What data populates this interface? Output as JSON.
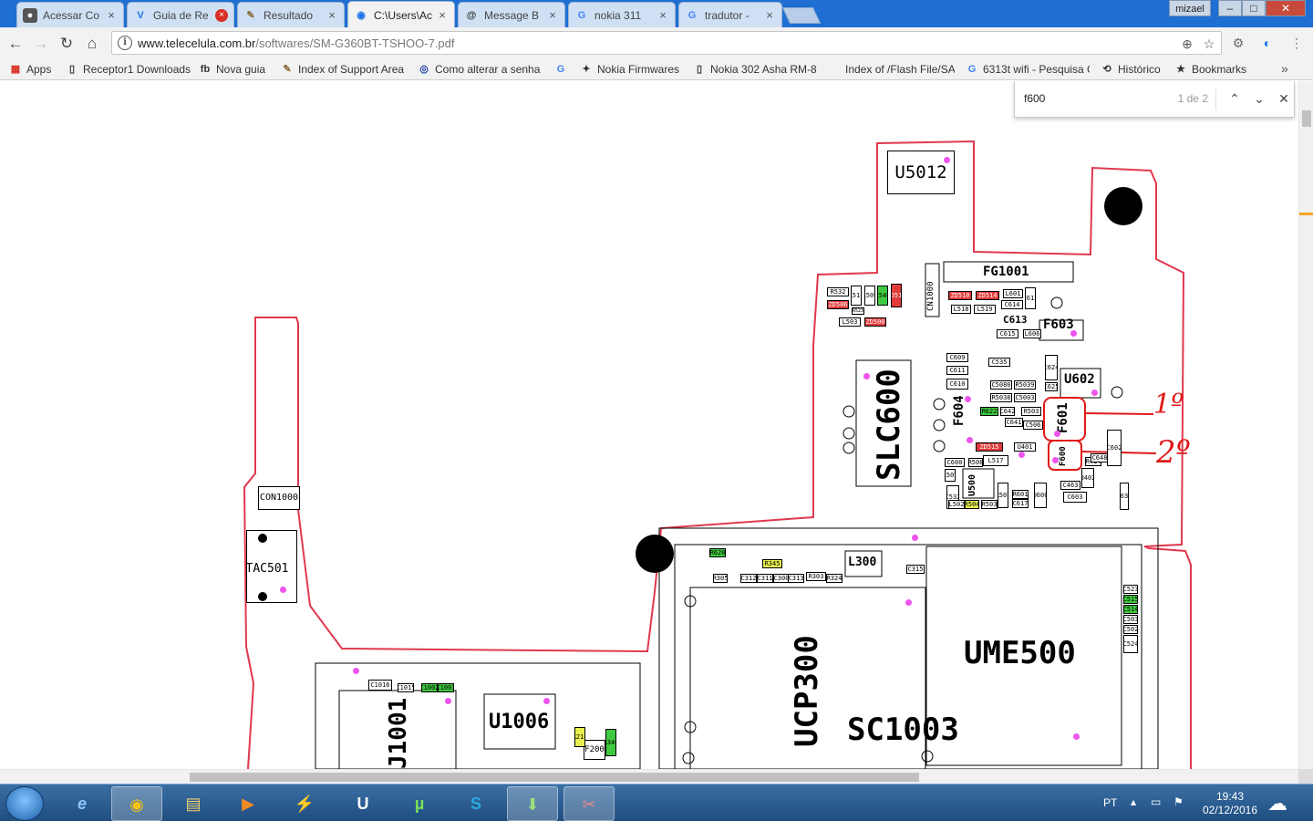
{
  "window": {
    "user": "mizael",
    "controls": {
      "minimize": "–",
      "maximize": "□",
      "close": "✕"
    }
  },
  "tabs": [
    {
      "title": "Acessar Co",
      "icon": "incognito-icon",
      "icon_glyph": "●",
      "close": "×",
      "close_variant": "normal",
      "active": false
    },
    {
      "title": "Guia de Re",
      "icon": "vpn-icon",
      "icon_glyph": "V",
      "close": "×",
      "close_variant": "error",
      "active": false
    },
    {
      "title": "Resultado",
      "icon": "pen-icon",
      "icon_glyph": "✎",
      "close": "×",
      "close_variant": "normal",
      "active": false
    },
    {
      "title": "C:\\Users\\Ac",
      "icon": "globe-icon",
      "icon_glyph": "◉",
      "close": "×",
      "close_variant": "normal",
      "active": true
    },
    {
      "title": "Message B",
      "icon": "spiral-icon",
      "icon_glyph": "@",
      "close": "×",
      "close_variant": "normal",
      "active": false
    },
    {
      "title": "nokia 311",
      "icon": "google-icon",
      "icon_glyph": "G",
      "close": "×",
      "close_variant": "normal",
      "active": false
    },
    {
      "title": "tradutor - ",
      "icon": "google-icon",
      "icon_glyph": "G",
      "close": "×",
      "close_variant": "normal",
      "active": false
    }
  ],
  "toolbar": {
    "back": "←",
    "forward": "→",
    "reload": "↻",
    "home": "⌂",
    "info": "i",
    "url_host": "www.telecelula.com.br",
    "url_path": "/softwares/SM-G360BT-TSHOO-7.pdf",
    "zoom_glyph": "⊕",
    "star_glyph": "☆",
    "ext1": "⚙",
    "ext2": "◐",
    "menu": "⋮"
  },
  "bookmarks": [
    {
      "label": "Apps",
      "icon": "apps-grid-icon",
      "glyph": "▦",
      "color": "#d93025"
    },
    {
      "label": "Receptor1 Downloads",
      "icon": "page-icon",
      "glyph": "▯",
      "color": "#555555"
    },
    {
      "label": "Nova guia",
      "icon": "facebook-icon",
      "glyph": "fb",
      "color": "#333333"
    },
    {
      "label": "Index of Support Area",
      "icon": "pen-icon",
      "glyph": "✎",
      "color": "#8a6d3b"
    },
    {
      "label": "Como alterar a senha",
      "icon": "tplink-icon",
      "glyph": "◎",
      "color": "#1a3ba8"
    },
    {
      "label": "",
      "icon": "google-icon",
      "glyph": "G",
      "color": "#4285f4"
    },
    {
      "label": "Nokia Firmwares",
      "icon": "wrench-icon",
      "glyph": "✦",
      "color": "#333333"
    },
    {
      "label": "Nokia 302 Asha RM-8",
      "icon": "page-icon",
      "glyph": "▯",
      "color": "#555555"
    },
    {
      "label": "Index of /Flash File/SA",
      "icon": "",
      "glyph": "",
      "color": "#555555"
    },
    {
      "label": "6313t wifi - Pesquisa G",
      "icon": "google-icon",
      "glyph": "G",
      "color": "#4285f4"
    },
    {
      "label": "Histórico",
      "icon": "history-icon",
      "glyph": "⟲",
      "color": "#555555"
    },
    {
      "label": "Bookmarks",
      "icon": "star-icon",
      "glyph": "★",
      "color": "#555555"
    }
  ],
  "bookmarks_more": "»",
  "findbar": {
    "query": "f600",
    "count": "1 de 2",
    "prev": "⌃",
    "next": "⌄",
    "close": "✕"
  },
  "schematic": {
    "big_labels": {
      "u5012": "U5012",
      "fg1001": "FG1001",
      "slc600": "SLC600",
      "ume500": "UME500",
      "ucp300": "UCP300",
      "sc1003": "SC1003",
      "u1006": "U1006",
      "j1001": "J1001",
      "u602": "U602",
      "f603": "F603",
      "f601": "F601",
      "f604": "F604",
      "tac501": "TAC501",
      "con1000": "CON1000",
      "l300": "L300",
      "cn1000": "CN1000",
      "f600": "F600",
      "f200": "F200",
      "u500": "U500",
      "c613": "C613"
    },
    "small_labels": [
      "R532",
      "ZD506",
      "R523",
      "L511",
      "L509",
      "C546",
      "ZD512",
      "L503",
      "ZD500",
      "ZD510",
      "ZD514",
      "L601",
      "C612",
      "L518",
      "L519",
      "C614",
      "C615",
      "L606",
      "C609",
      "C611",
      "C610",
      "C535",
      "C5080",
      "R5039",
      "R5038",
      "C5003",
      "C624",
      "C625",
      "R622",
      "C642",
      "R503",
      "C641",
      "C506",
      "ZD515",
      "U401",
      "L517",
      "R508",
      "C600",
      "L507",
      "C532",
      "L502",
      "R504",
      "R503",
      "R507",
      "C617",
      "R601",
      "U600",
      "C603",
      "U402",
      "R414",
      "C463",
      "C648",
      "C602",
      "R620",
      "R630",
      "R345",
      "C315",
      "R305",
      "C312",
      "C311",
      "C300",
      "C313",
      "R303",
      "R324",
      "C1016",
      "C1015",
      "C1002",
      "C1003",
      "C523",
      "C515",
      "C514",
      "C503",
      "C502",
      "C524",
      "R211",
      "R340"
    ],
    "annotations": {
      "first": "1º",
      "second": "2º"
    }
  },
  "taskbar": {
    "apps": [
      {
        "name": "ie",
        "glyph": "e"
      },
      {
        "name": "chrome",
        "glyph": "◉"
      },
      {
        "name": "explorer",
        "glyph": "▤"
      },
      {
        "name": "media",
        "glyph": "▶"
      },
      {
        "name": "winamp",
        "glyph": "⚡"
      },
      {
        "name": "uc",
        "glyph": "U"
      },
      {
        "name": "utorrent",
        "glyph": "µ"
      },
      {
        "name": "skype",
        "glyph": "S"
      },
      {
        "name": "install",
        "glyph": "⬇"
      },
      {
        "name": "tools",
        "glyph": "✂"
      }
    ],
    "lang": "PT",
    "tray_up": "▴",
    "tray_monitor": "▭",
    "tray_flag": "⚑",
    "time": "19:43",
    "date": "02/12/2016",
    "weather": "☁"
  },
  "colors": {
    "board_outline": "#e0384f",
    "annotation": "#e01818",
    "testpoint": "#ee55ee",
    "green": "#3ec93e",
    "yellow": "#e8f050"
  }
}
